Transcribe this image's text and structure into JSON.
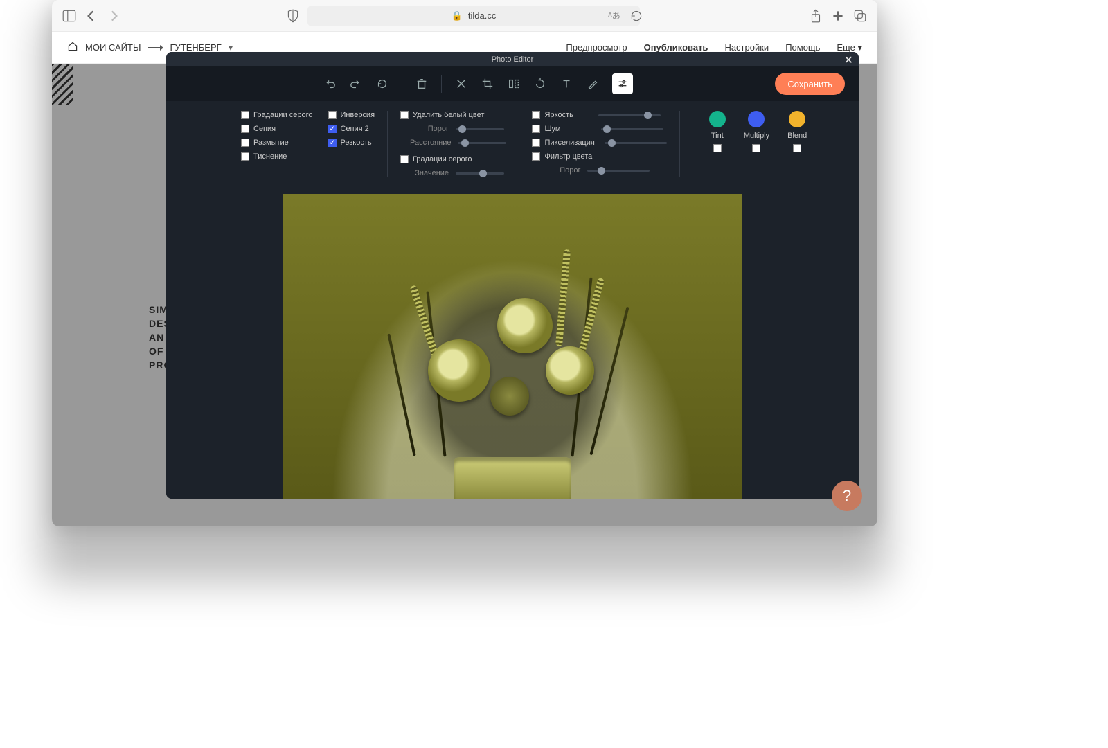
{
  "browser": {
    "url": "tilda.cc"
  },
  "tilda": {
    "mysites": "МОИ САЙТЫ",
    "project": "ГУТЕНБЕРГ",
    "preview": "Предпросмотр",
    "publish": "Опубликовать",
    "settings": "Настройки",
    "help": "Помощь",
    "more": "Еще"
  },
  "page": {
    "bgtext": "SIMPLICITY\nDESCRIBES\nAN ORGANIZER\nOF COMPLEX\nPROCESSES"
  },
  "editor": {
    "title": "Photo Editor",
    "save": "Сохранить",
    "checks": {
      "grayscale": "Градации серого",
      "sepia": "Сепия",
      "blur": "Размытие",
      "emboss": "Тиснение",
      "invert": "Инверсия",
      "sepia2": "Сепия 2",
      "sharpen": "Резкость"
    },
    "filters": {
      "removewhite": "Удалить белый цвет",
      "rw_threshold": "Порог",
      "rw_distance": "Расстояние",
      "grayscale2": "Градации серого",
      "gs_value": "Значение"
    },
    "filters2": {
      "brightness": "Яркость",
      "noise": "Шум",
      "pixelate": "Пикселизация",
      "colorfilter": "Фильтр цвета",
      "cf_threshold": "Порог"
    },
    "sliders": {
      "rw_threshold": 12,
      "rw_distance": 12,
      "gs_value": 55,
      "brightness": 78,
      "noise": 8,
      "pixelate": 10,
      "cf_threshold": 20
    },
    "colors": {
      "tint": "Tint",
      "multiply": "Multiply",
      "blend": "Blend",
      "tint_hex": "#14b38c",
      "multiply_hex": "#3e5df0",
      "blend_hex": "#f2b32c"
    }
  }
}
